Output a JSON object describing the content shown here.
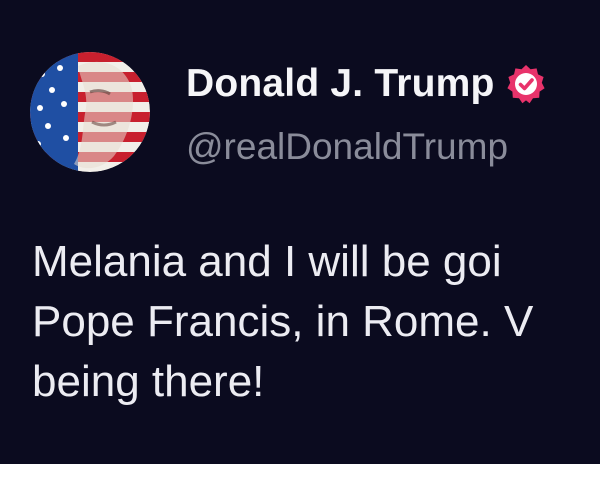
{
  "post": {
    "author": {
      "display_name": "Donald J. Trump",
      "handle": "@realDonaldTrump",
      "verified": true,
      "avatar_icon": "flag-portrait-avatar",
      "badge_icon": "verified-check-icon",
      "badge_color": "#e8336b"
    },
    "text_lines": [
      "Melania and I will be goi",
      "Pope Francis, in Rome. V",
      "being there!"
    ]
  },
  "colors": {
    "card_background": "#0b0b1f",
    "name_text": "#f5f5f8",
    "handle_text": "#8a8c9a",
    "body_text": "#ececf2",
    "flag_red": "#c8202e",
    "flag_blue": "#1f4fa3"
  }
}
